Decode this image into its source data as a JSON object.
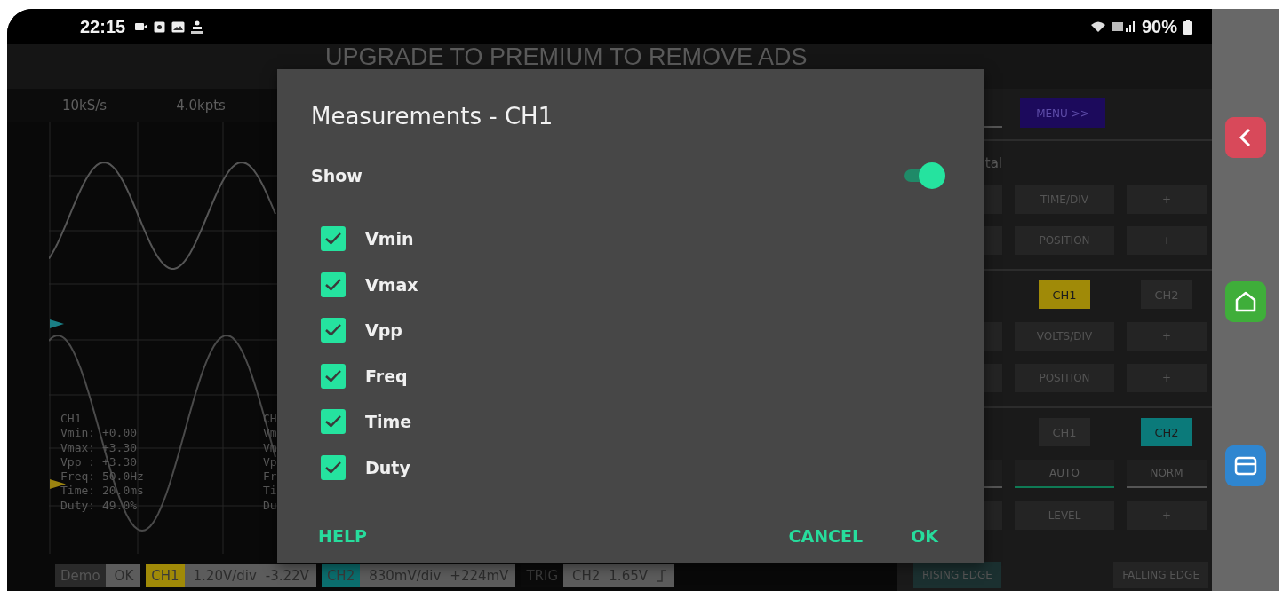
{
  "status_bar": {
    "time": "22:15",
    "battery": "90%"
  },
  "banner": "UPGRADE TO PREMIUM TO REMOVE ADS",
  "scope": {
    "sample_rate": "10kS/s",
    "record_length": "4.0kpts",
    "measurements": [
      {
        "title": "CH1",
        "lines": [
          "Vmin: +0.00",
          "Vmax: +3.30",
          "Vpp : +3.30",
          "Freq: 50.0Hz",
          "Time: 20.0ms",
          "Duty: 49.0%"
        ]
      },
      {
        "title": "CH",
        "lines": [
          "Vm",
          "Vm",
          "Vp",
          "Fr",
          "Ti",
          "Du"
        ]
      }
    ]
  },
  "bottom_bar": [
    {
      "kind": "mode",
      "label": "Demo",
      "values": [
        "OK"
      ]
    },
    {
      "kind": "channel",
      "label": "CH1",
      "color": "#a08a08",
      "values": [
        "1.20V/div",
        "-3.22V"
      ]
    },
    {
      "kind": "channel",
      "label": "CH2",
      "color": "#0b6e6e",
      "values": [
        "830mV/div",
        "+224mV"
      ]
    },
    {
      "kind": "trigger",
      "label": "TRIG",
      "values": [
        "CH2",
        "1.65V"
      ]
    }
  ],
  "panel": {
    "sections": [
      {
        "rows": [
          {
            "kind": "menu",
            "label": "MENU >>"
          }
        ]
      },
      {
        "rows": [
          {
            "kind": "heading",
            "label": "tal"
          },
          {
            "kind": "control",
            "label": "TIME/DIV",
            "step": "+"
          },
          {
            "kind": "control",
            "label": "POSITION",
            "step": "+"
          }
        ]
      },
      {
        "rows": [
          {
            "kind": "channels",
            "options": [
              {
                "label": "CH1",
                "selected": true,
                "color": "#a08a08"
              },
              {
                "label": "CH2",
                "selected": false
              }
            ]
          },
          {
            "kind": "control",
            "label": "VOLTS/DIV",
            "step": "+"
          },
          {
            "kind": "control",
            "label": "POSITION",
            "step": "+"
          }
        ]
      },
      {
        "rows": [
          {
            "kind": "channels",
            "options": [
              {
                "label": "CH1",
                "selected": false
              },
              {
                "label": "CH2",
                "selected": true,
                "color": "#0b7a7a"
              }
            ]
          },
          {
            "kind": "modes",
            "options": [
              {
                "label": "AUTO",
                "selected": true
              },
              {
                "label": "NORM",
                "selected": false
              }
            ]
          },
          {
            "kind": "control",
            "label": "LEVEL",
            "step": "+"
          },
          {
            "kind": "edges",
            "options": [
              {
                "label": "RISING EDGE",
                "selected": true
              },
              {
                "label": "FALLING EDGE",
                "selected": false
              }
            ]
          }
        ]
      }
    ]
  },
  "dialog": {
    "title": "Measurements - CH1",
    "show": {
      "label": "Show",
      "on": true
    },
    "items": [
      {
        "label": "Vmin",
        "checked": true
      },
      {
        "label": "Vmax",
        "checked": true
      },
      {
        "label": "Vpp",
        "checked": true
      },
      {
        "label": "Freq",
        "checked": true
      },
      {
        "label": "Time",
        "checked": true
      },
      {
        "label": "Duty",
        "checked": true
      }
    ],
    "buttons": [
      {
        "label": "HELP"
      },
      {
        "label": "CANCEL"
      },
      {
        "label": "OK"
      }
    ]
  }
}
